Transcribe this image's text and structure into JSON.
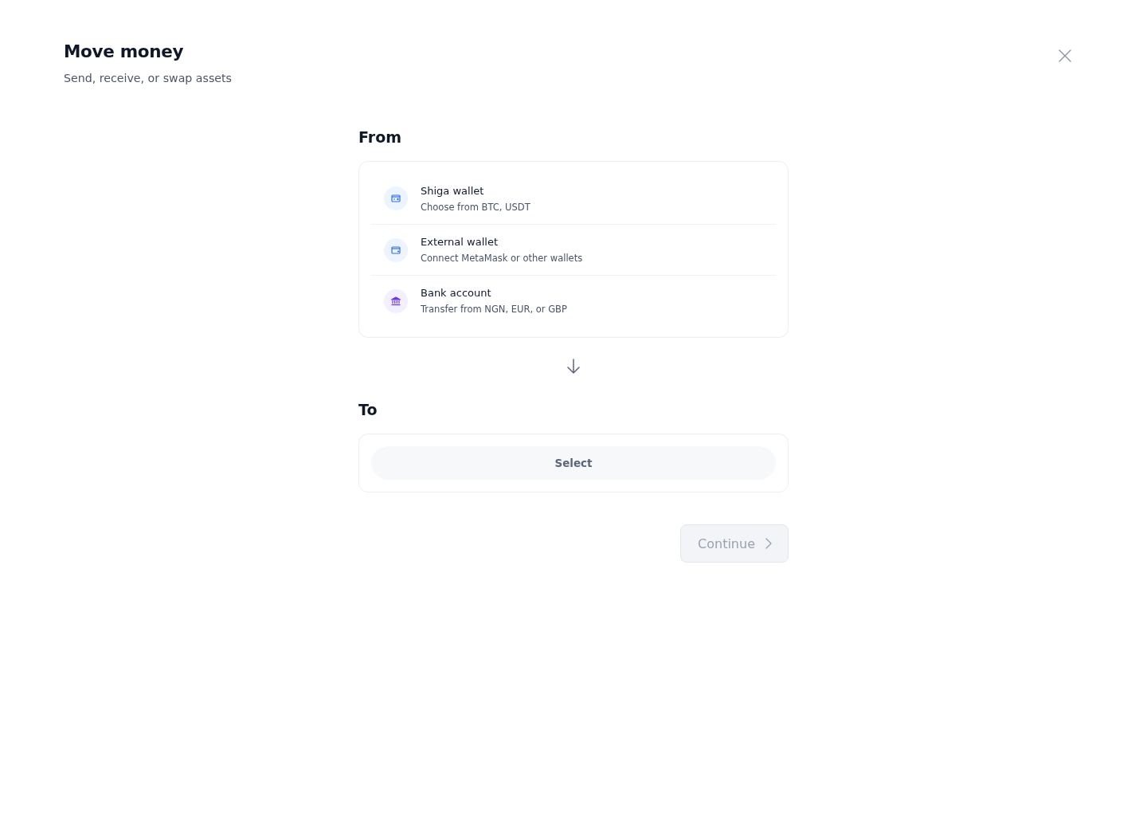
{
  "header": {
    "title": "Move money",
    "subtitle": "Send, receive, or swap assets"
  },
  "from": {
    "label": "From",
    "options": [
      {
        "kind": "card-wallet",
        "title": "Shiga wallet",
        "description": "Choose from BTC, USDT"
      },
      {
        "kind": "wallet",
        "title": "External wallet",
        "description": "Connect MetaMask or other wallets"
      },
      {
        "kind": "bank",
        "title": "Bank account",
        "description": "Transfer from NGN, EUR, or GBP"
      }
    ]
  },
  "to": {
    "label": "To",
    "select": {
      "label": "Select"
    }
  },
  "continue_button": {
    "label": "Continue",
    "disabled": true
  }
}
